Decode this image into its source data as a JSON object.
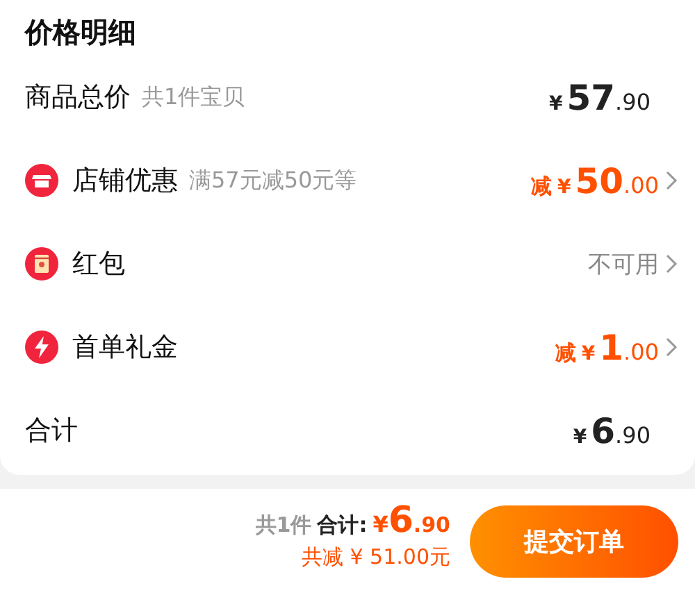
{
  "title": "价格明细",
  "rows": [
    {
      "kind": "total",
      "label": "商品总价",
      "note": "共1件宝贝",
      "value": {
        "kind": "price",
        "discount": false,
        "currency": "¥",
        "integer": "57",
        "decimal": ".90"
      }
    },
    {
      "kind": "shop",
      "label": "店铺优惠",
      "note": "满57元减50元等",
      "value": {
        "kind": "price",
        "discount": true,
        "prefix": "减",
        "currency": "¥",
        "integer": "50",
        "decimal": ".00"
      },
      "chevron": true
    },
    {
      "kind": "packet",
      "label": "红包",
      "value": {
        "kind": "text",
        "text": "不可用"
      },
      "chevron": true
    },
    {
      "kind": "flash",
      "label": "首单礼金",
      "value": {
        "kind": "price",
        "discount": true,
        "prefix": "减",
        "currency": "¥",
        "integer": "1",
        "decimal": ".00"
      },
      "chevron": true
    },
    {
      "kind": "sum",
      "label": "合计",
      "value": {
        "kind": "price",
        "discount": false,
        "currency": "¥",
        "integer": "6",
        "decimal": ".90"
      }
    }
  ],
  "footer": {
    "count": "共1件",
    "total_label": "合计:",
    "currency": "¥",
    "integer": "6",
    "decimal": ".90",
    "saved": "共减 ¥ 51.00元",
    "button": "提交订单"
  }
}
